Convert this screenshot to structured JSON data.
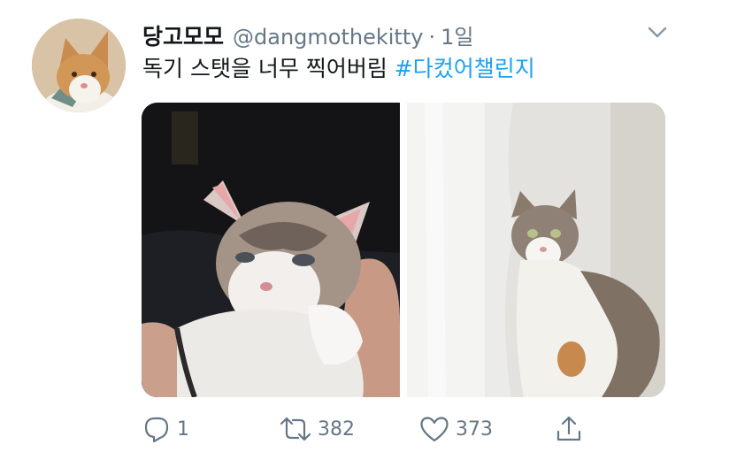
{
  "tweet": {
    "author_name": "당고모모",
    "handle": "@dangmothekitty",
    "separator": "·",
    "time": "1일",
    "text": "독기 스탯을 너무 찍어버림",
    "hashtag": "#다컸어챌린지"
  },
  "actions": {
    "reply_count": "1",
    "retweet_count": "382",
    "like_count": "373"
  },
  "colors": {
    "link": "#1da1f2",
    "secondary_text": "#657786",
    "primary_text": "#14171a"
  },
  "icons": [
    "chevron-down-icon",
    "reply-icon",
    "retweet-icon",
    "heart-icon",
    "share-icon"
  ]
}
